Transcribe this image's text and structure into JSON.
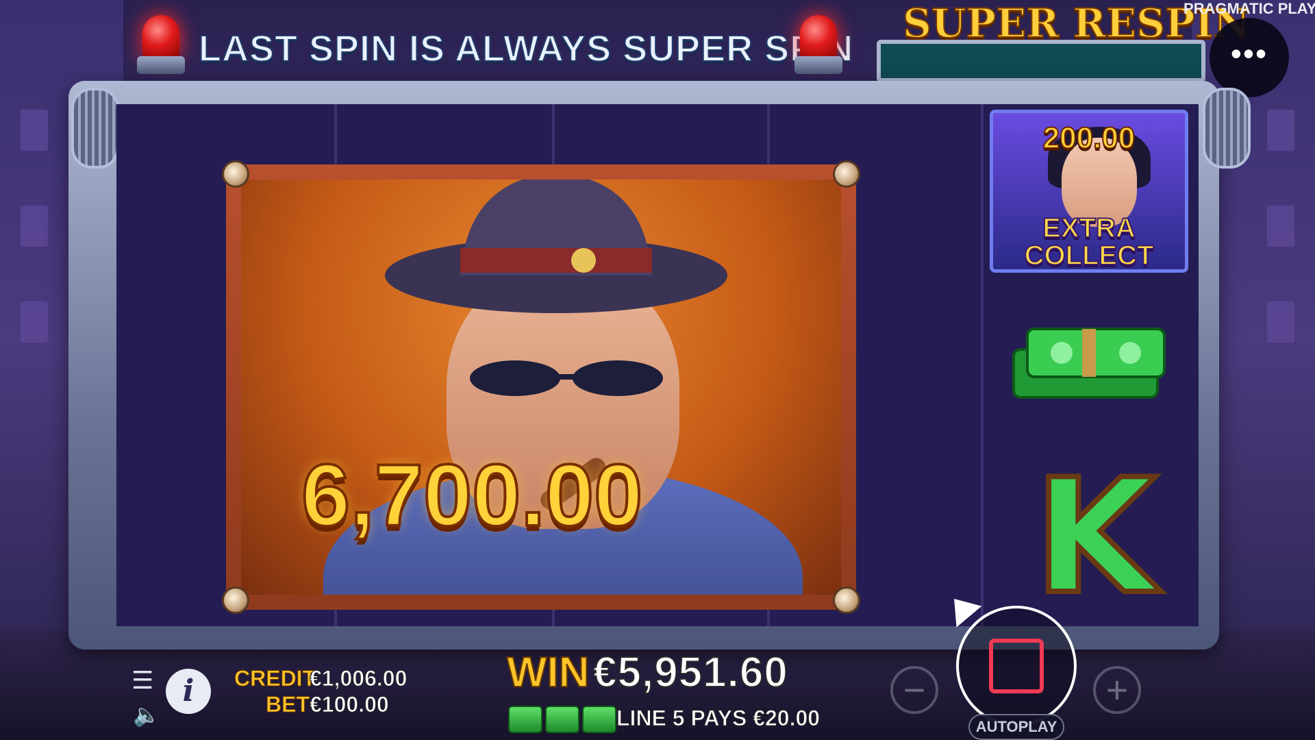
{
  "banner": {
    "text": "LAST SPIN IS ALWAYS SUPER SPIN"
  },
  "super_respin": {
    "title": "SUPER RESPIN"
  },
  "brand": "PRAGMATIC PLAY",
  "menu": {
    "label": "•••"
  },
  "reels": {
    "big_symbol_amount": "6,700.00",
    "collect_symbol": {
      "amount": "200.00",
      "label_line1": "EXTRA",
      "label_line2": "COLLECT"
    },
    "letter_symbol": "K"
  },
  "hud": {
    "credit_label": "CREDIT",
    "credit_value": "€1,006.00",
    "bet_label": "BET",
    "bet_value": "€100.00",
    "win_label": "WIN",
    "win_value": "€5,951.60",
    "line_pays": "LINE 5 PAYS €20.00",
    "info_label": "i",
    "minus_label": "−",
    "plus_label": "+",
    "autoplay_label": "AUTOPLAY"
  },
  "colors": {
    "accent_gold": "#ffc52a",
    "stop_red": "#ef3a55",
    "reel_bg": "#241c52"
  }
}
